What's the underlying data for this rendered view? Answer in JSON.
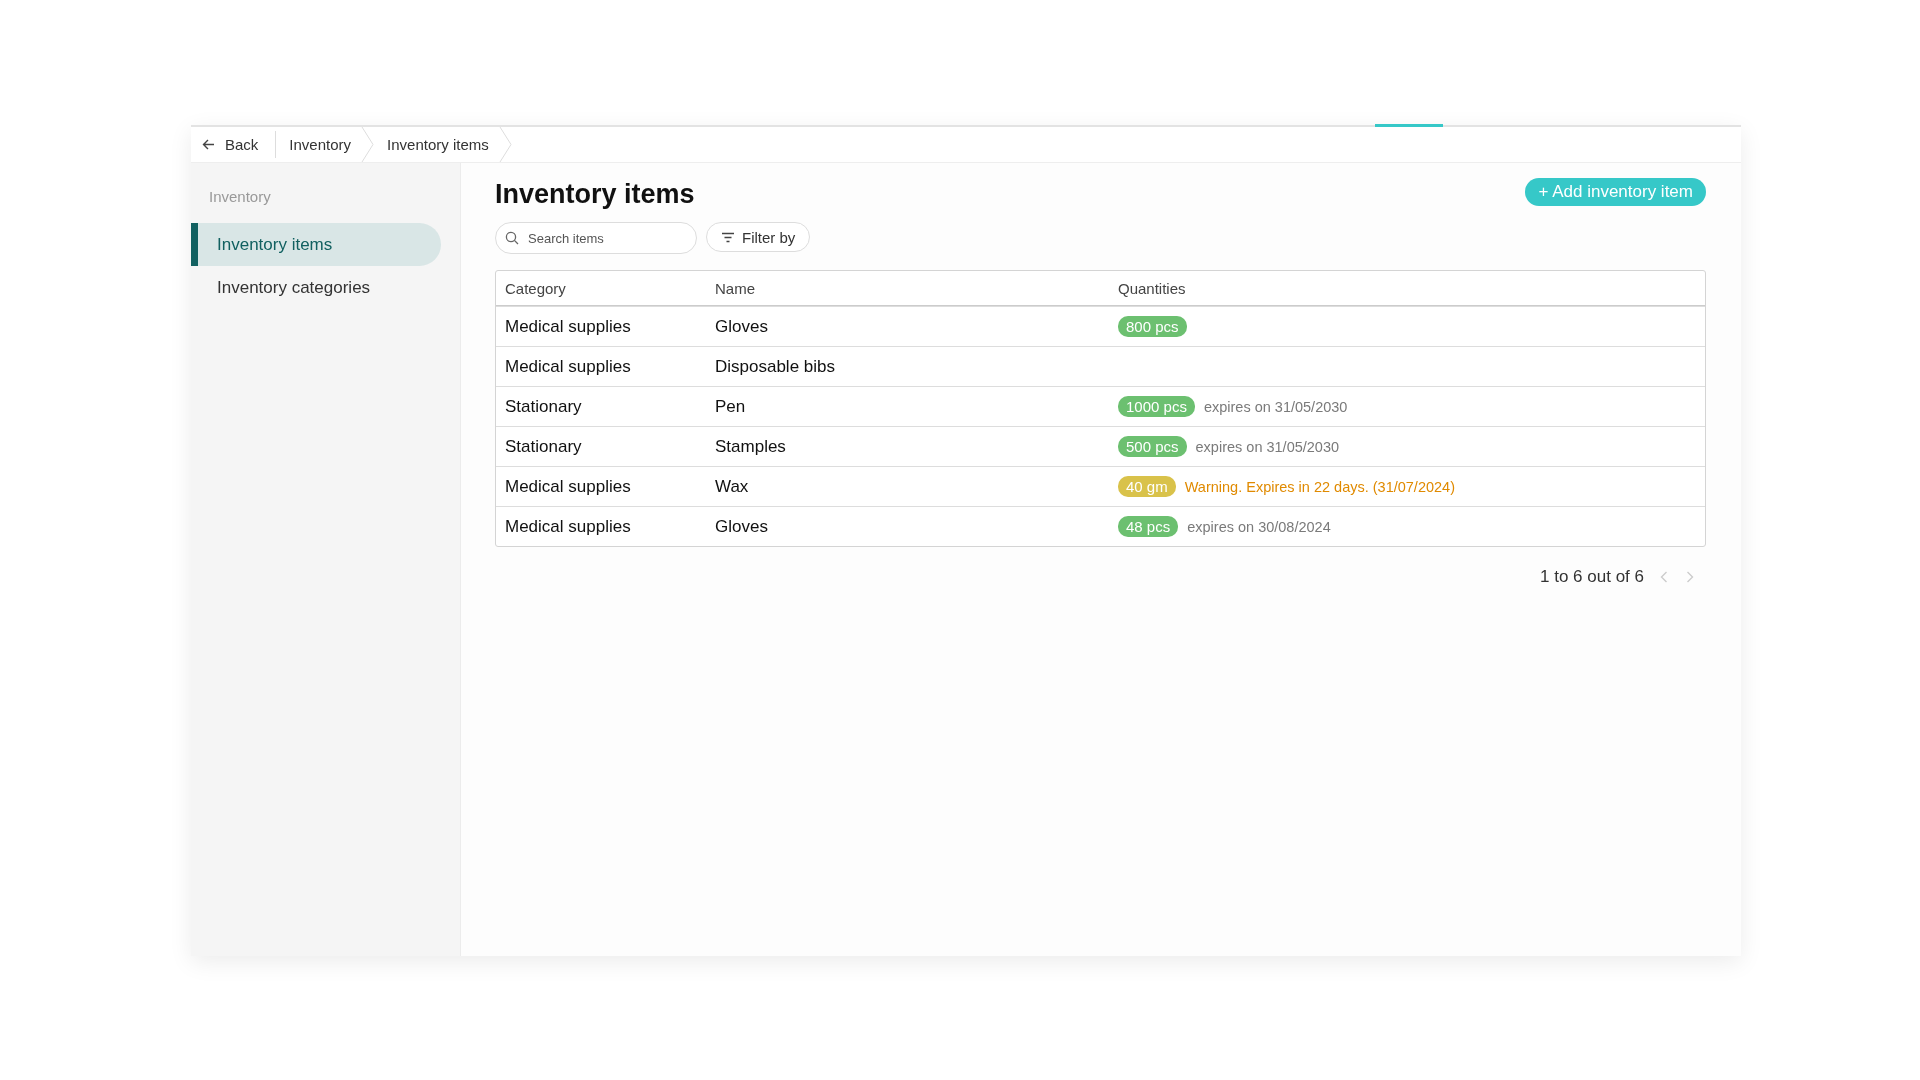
{
  "breadcrumb": {
    "back": "Back",
    "items": [
      "Inventory",
      "Inventory items"
    ]
  },
  "sidebar": {
    "heading": "Inventory",
    "items": [
      {
        "label": "Inventory items",
        "selected": true
      },
      {
        "label": "Inventory categories",
        "selected": false
      }
    ]
  },
  "page": {
    "title": "Inventory items",
    "add_button": "+ Add inventory item"
  },
  "search": {
    "placeholder": "Search items"
  },
  "filter_button": "Filter by",
  "table": {
    "columns": [
      "Category",
      "Name",
      "Quantities"
    ],
    "rows": [
      {
        "category": "Medical supplies",
        "name": "Gloves",
        "quantity": {
          "text": "800 pcs",
          "color": "#6cc070"
        }
      },
      {
        "category": "Medical supplies",
        "name": "Disposable bibs"
      },
      {
        "category": "Stationary",
        "name": "Pen",
        "quantity": {
          "text": "1000 pcs",
          "color": "#6cc070"
        },
        "note": {
          "text": "expires on 31/05/2030",
          "kind": "normal"
        }
      },
      {
        "category": "Stationary",
        "name": "Stamples",
        "quantity": {
          "text": "500 pcs",
          "color": "#6cc070"
        },
        "note": {
          "text": "expires on 31/05/2030",
          "kind": "normal"
        }
      },
      {
        "category": "Medical supplies",
        "name": "Wax",
        "quantity": {
          "text": "40 gm",
          "color": "#d9c24a"
        },
        "note": {
          "text": "Warning. Expires in 22 days. (31/07/2024)",
          "kind": "warning"
        }
      },
      {
        "category": "Medical supplies",
        "name": "Gloves",
        "quantity": {
          "text": "48 pcs",
          "color": "#6cc070"
        },
        "note": {
          "text": "expires on 30/08/2024",
          "kind": "normal"
        }
      }
    ]
  },
  "pagination": {
    "summary": "1 to 6 out of 6",
    "prev_disabled": true,
    "next_disabled": true
  }
}
